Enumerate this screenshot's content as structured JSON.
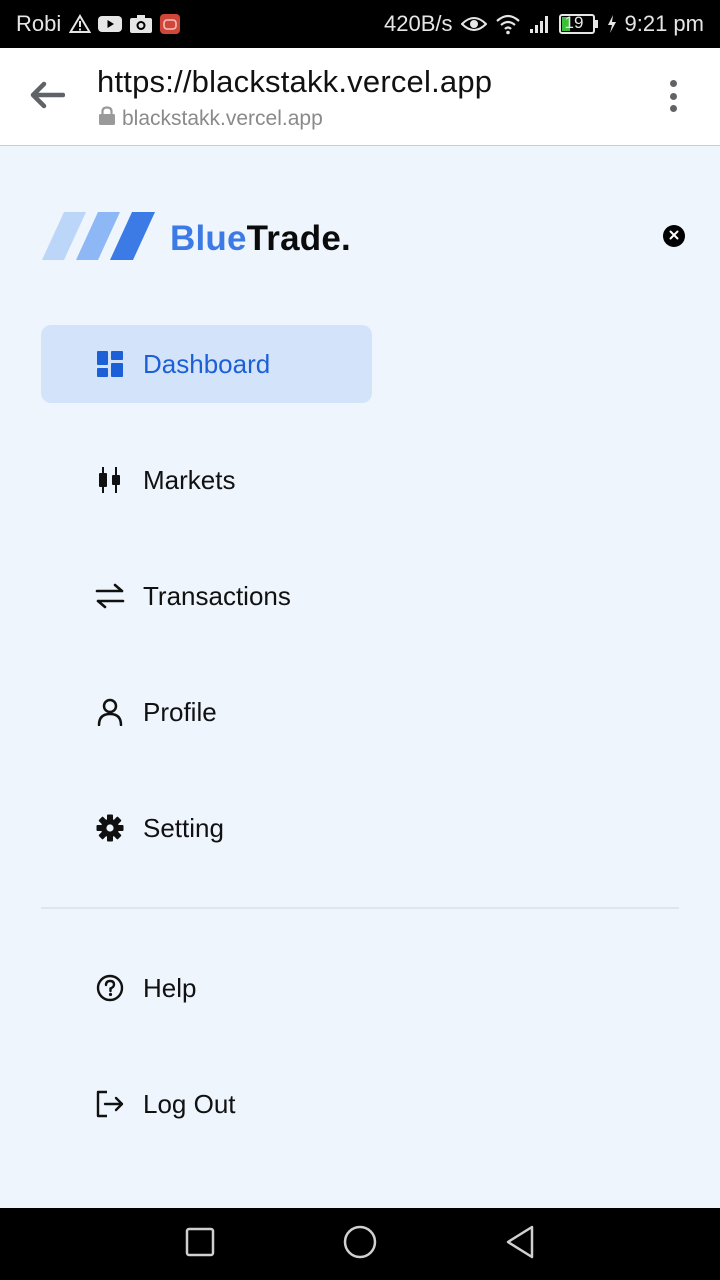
{
  "status_bar": {
    "carrier": "Robi",
    "net_speed": "420B/s",
    "battery": "19",
    "time": "9:21 pm",
    "icons": [
      "warning-icon",
      "youtube-icon",
      "camera-icon",
      "app-notification-icon",
      "eye-icon",
      "wifi-icon",
      "signal-icon",
      "battery-icon",
      "charging-icon"
    ]
  },
  "browser": {
    "title": "https://blackstakk.vercel.app",
    "domain": "blackstakk.vercel.app",
    "icons": [
      "back-arrow-icon",
      "lock-icon",
      "more-vert-icon"
    ]
  },
  "brand": {
    "name_accent": "Blue",
    "name_main": "Trade.",
    "colors": {
      "accent": "#3c7be6",
      "stripe_light": "#bcd6fa",
      "stripe_mid": "#8db8f5",
      "stripe_dark": "#3c7be6"
    }
  },
  "sidebar": {
    "items": [
      {
        "label": "Dashboard",
        "icon": "dashboard-icon",
        "active": true
      },
      {
        "label": "Markets",
        "icon": "candlestick-icon",
        "active": false
      },
      {
        "label": "Transactions",
        "icon": "swap-arrows-icon",
        "active": false
      },
      {
        "label": "Profile",
        "icon": "user-icon",
        "active": false
      },
      {
        "label": "Setting",
        "icon": "gear-icon",
        "active": false
      }
    ],
    "footer_items": [
      {
        "label": "Help",
        "icon": "help-circle-icon"
      },
      {
        "label": "Log Out",
        "icon": "logout-icon"
      }
    ],
    "colors": {
      "active_bg": "#d3e4fa",
      "active_text": "#1c5fd6",
      "page_bg": "#eef5fd"
    }
  },
  "system_nav": {
    "icons": [
      "recents-square-icon",
      "home-circle-icon",
      "back-triangle-icon"
    ]
  }
}
